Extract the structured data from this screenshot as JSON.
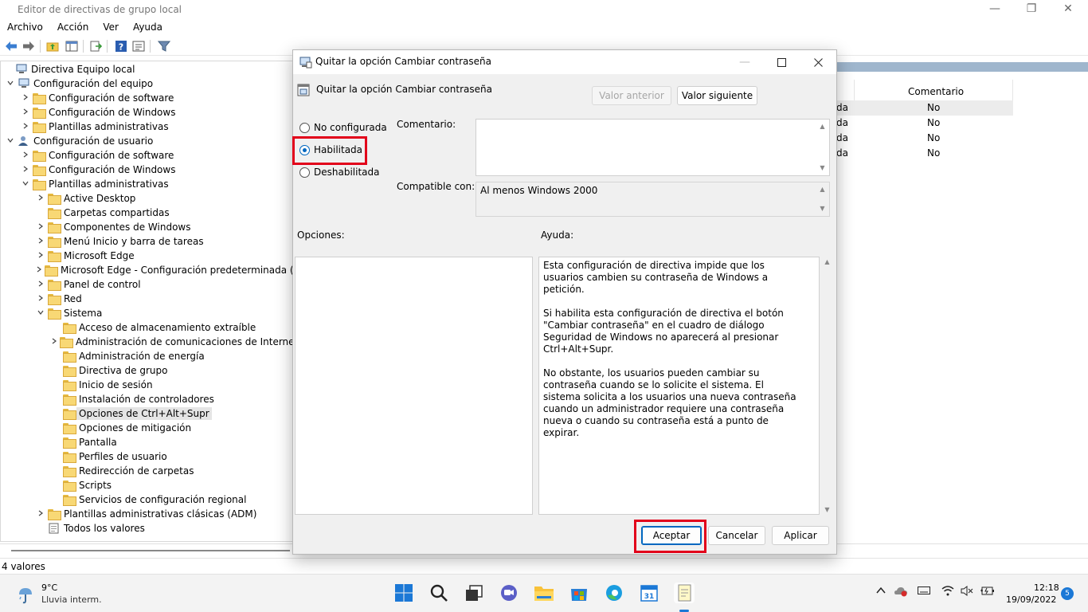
{
  "window": {
    "title": "Editor de directivas de grupo local",
    "minimize": "—",
    "maximize": "❐",
    "close": "✕"
  },
  "menu": [
    "Archivo",
    "Acción",
    "Ver",
    "Ayuda"
  ],
  "toolbar_icons": [
    "back-arrow-icon",
    "forward-arrow-icon",
    "up-folder-icon",
    "show-tree-icon",
    "export-list-icon",
    "help-icon",
    "properties-icon",
    "filter-icon"
  ],
  "tree": [
    {
      "label": "Directiva Equipo local",
      "level": 0,
      "chevron": "",
      "icon": "computer-policy-icon"
    },
    {
      "label": "Configuración del equipo",
      "level": 0,
      "chevron": "v",
      "icon": "computer-icon"
    },
    {
      "label": "Configuración de software",
      "level": 1,
      "chevron": ">",
      "icon": "folder-icon"
    },
    {
      "label": "Configuración de Windows",
      "level": 1,
      "chevron": ">",
      "icon": "folder-icon"
    },
    {
      "label": "Plantillas administrativas",
      "level": 1,
      "chevron": ">",
      "icon": "folder-icon"
    },
    {
      "label": "Configuración de usuario",
      "level": 0,
      "chevron": "v",
      "icon": "user-icon"
    },
    {
      "label": "Configuración de software",
      "level": 1,
      "chevron": ">",
      "icon": "folder-icon"
    },
    {
      "label": "Configuración de Windows",
      "level": 1,
      "chevron": ">",
      "icon": "folder-icon"
    },
    {
      "label": "Plantillas administrativas",
      "level": 1,
      "chevron": "v",
      "icon": "folder-icon"
    },
    {
      "label": "Active Desktop",
      "level": 2,
      "chevron": ">",
      "icon": "folder-icon"
    },
    {
      "label": "Carpetas compartidas",
      "level": 2,
      "chevron": "",
      "icon": "folder-icon"
    },
    {
      "label": "Componentes de Windows",
      "level": 2,
      "chevron": ">",
      "icon": "folder-icon"
    },
    {
      "label": "Menú Inicio y barra de tareas",
      "level": 2,
      "chevron": ">",
      "icon": "folder-icon"
    },
    {
      "label": "Microsoft Edge",
      "level": 2,
      "chevron": ">",
      "icon": "folder-icon"
    },
    {
      "label": "Microsoft Edge - Configuración predeterminada (los u",
      "level": 2,
      "chevron": ">",
      "icon": "folder-icon"
    },
    {
      "label": "Panel de control",
      "level": 2,
      "chevron": ">",
      "icon": "folder-icon"
    },
    {
      "label": "Red",
      "level": 2,
      "chevron": ">",
      "icon": "folder-icon"
    },
    {
      "label": "Sistema",
      "level": 2,
      "chevron": "v",
      "icon": "folder-icon"
    },
    {
      "label": "Acceso de almacenamiento extraíble",
      "level": 3,
      "chevron": "",
      "icon": "folder-icon"
    },
    {
      "label": "Administración de comunicaciones de Internet",
      "level": 3,
      "chevron": ">",
      "icon": "folder-icon"
    },
    {
      "label": "Administración de energía",
      "level": 3,
      "chevron": "",
      "icon": "folder-icon"
    },
    {
      "label": "Directiva de grupo",
      "level": 3,
      "chevron": "",
      "icon": "folder-icon"
    },
    {
      "label": "Inicio de sesión",
      "level": 3,
      "chevron": "",
      "icon": "folder-icon"
    },
    {
      "label": "Instalación de controladores",
      "level": 3,
      "chevron": "",
      "icon": "folder-icon"
    },
    {
      "label": "Opciones de Ctrl+Alt+Supr",
      "level": 3,
      "chevron": "",
      "icon": "folder-icon",
      "selected": true
    },
    {
      "label": "Opciones de mitigación",
      "level": 3,
      "chevron": "",
      "icon": "folder-icon"
    },
    {
      "label": "Pantalla",
      "level": 3,
      "chevron": "",
      "icon": "folder-icon"
    },
    {
      "label": "Perfiles de usuario",
      "level": 3,
      "chevron": "",
      "icon": "folder-icon"
    },
    {
      "label": "Redirección de carpetas",
      "level": 3,
      "chevron": "",
      "icon": "folder-icon"
    },
    {
      "label": "Scripts",
      "level": 3,
      "chevron": "",
      "icon": "folder-icon"
    },
    {
      "label": "Servicios de configuración regional",
      "level": 3,
      "chevron": "",
      "icon": "folder-icon"
    },
    {
      "label": "Plantillas administrativas clásicas (ADM)",
      "level": 2,
      "chevron": ">",
      "icon": "folder-icon"
    },
    {
      "label": "Todos los valores",
      "level": 2,
      "chevron": "",
      "icon": "all-settings-icon"
    }
  ],
  "right_pane": {
    "column_comment": "Comentario",
    "rows": [
      {
        "state": "da",
        "comment": "No"
      },
      {
        "state": "da",
        "comment": "No"
      },
      {
        "state": "da",
        "comment": "No"
      },
      {
        "state": "da",
        "comment": "No"
      }
    ]
  },
  "status": "4 valores",
  "dialog": {
    "title": "Quitar la opción Cambiar contraseña",
    "setting_name": "Quitar la opción Cambiar contraseña",
    "prev_button": "Valor anterior",
    "next_button": "Valor siguiente",
    "radios": [
      {
        "label": "No configurada",
        "checked": false
      },
      {
        "label": "Habilitada",
        "checked": true
      },
      {
        "label": "Deshabilitada",
        "checked": false
      }
    ],
    "comment_label": "Comentario:",
    "comment_value": "",
    "supported_label": "Compatible con:",
    "supported_value": "Al menos Windows 2000",
    "options_label": "Opciones:",
    "help_label": "Ayuda:",
    "help_paragraphs": [
      "Esta configuración de directiva impide que los usuarios cambien su contraseña de Windows a petición.",
      "Si habilita esta configuración de directiva el botón \"Cambiar contraseña\" en el cuadro de diálogo Seguridad de Windows no aparecerá al presionar Ctrl+Alt+Supr.",
      "No obstante, los usuarios pueden cambiar su contraseña cuando se lo solicite el sistema. El sistema solicita a los usuarios una nueva contraseña cuando un administrador requiere una contraseña nueva o cuando su contraseña está a punto de expirar."
    ],
    "ok_button": "Aceptar",
    "cancel_button": "Cancelar",
    "apply_button": "Aplicar"
  },
  "taskbar": {
    "weather_temp": "9°C",
    "weather_desc": "Lluvia interm.",
    "apps": [
      "start-icon",
      "search-icon",
      "task-view-icon",
      "chat-icon",
      "file-explorer-icon",
      "store-icon",
      "edge-icon",
      "calendar-icon",
      "notepad-icon"
    ],
    "calendar_day": "31",
    "time": "12:18",
    "date": "19/09/2022",
    "notifications": "5"
  },
  "colors": {
    "accent": "#0067c0",
    "highlight": "#e2001a"
  }
}
